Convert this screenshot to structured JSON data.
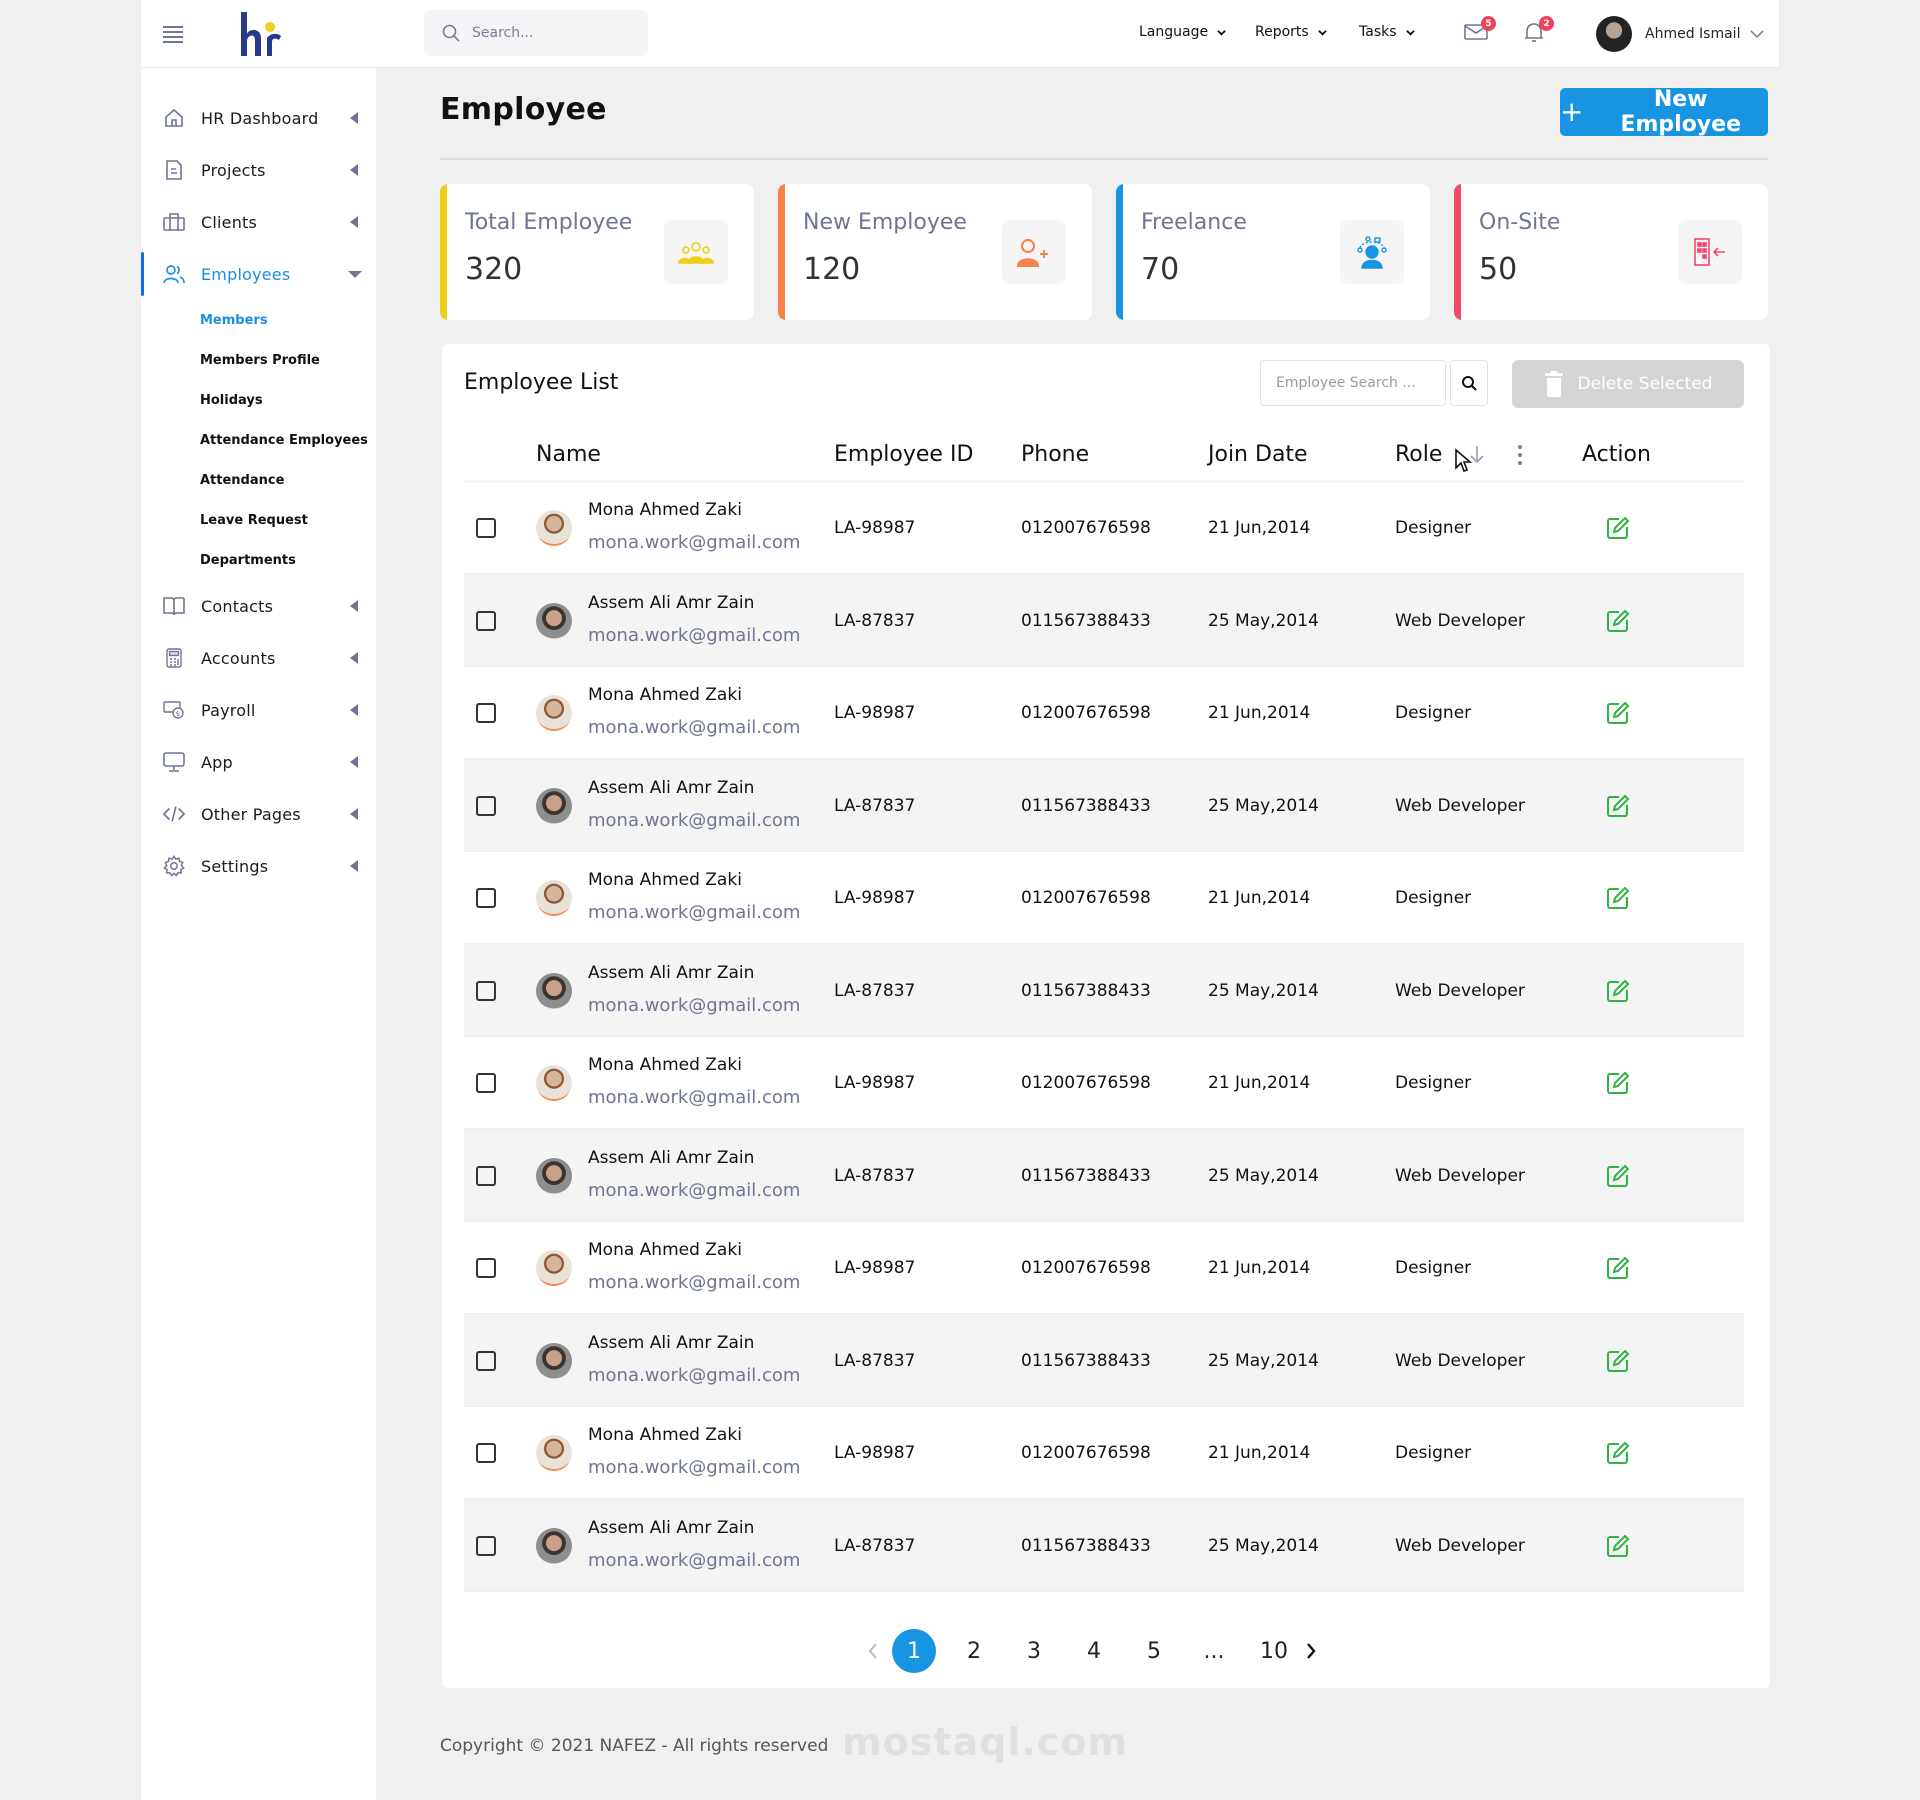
{
  "topbar": {
    "search_placeholder": "Search...",
    "menus": [
      {
        "label": "Language"
      },
      {
        "label": "Reports"
      },
      {
        "label": "Tasks"
      }
    ],
    "mail_count": "5",
    "notification_count": "2",
    "user_name": "Ahmed Ismail"
  },
  "sidebar": {
    "items": [
      {
        "label": "HR Dashboard",
        "icon": "home-icon"
      },
      {
        "label": "Projects",
        "icon": "document-icon"
      },
      {
        "label": "Clients",
        "icon": "briefcase-icon"
      },
      {
        "label": "Employees",
        "icon": "users-icon",
        "active": true
      },
      {
        "label": "Contacts",
        "icon": "book-icon"
      },
      {
        "label": "Accounts",
        "icon": "calculator-icon"
      },
      {
        "label": "Payroll",
        "icon": "money-icon"
      },
      {
        "label": "App",
        "icon": "monitor-icon"
      },
      {
        "label": "Other Pages",
        "icon": "code-icon"
      },
      {
        "label": "Settings",
        "icon": "gear-icon"
      }
    ],
    "sub_items": [
      {
        "label": "Members",
        "active": true
      },
      {
        "label": "Members Profile"
      },
      {
        "label": "Holidays"
      },
      {
        "label": "Attendance Employees"
      },
      {
        "label": "Attendance"
      },
      {
        "label": "Leave Request"
      },
      {
        "label": "Departments"
      }
    ]
  },
  "page": {
    "title": "Employee",
    "new_button": "New Employee"
  },
  "stats": [
    {
      "title": "Total Employee",
      "value": "320",
      "color": "#ecd019",
      "icon": "team-icon"
    },
    {
      "title": "New Employee",
      "value": "120",
      "color": "#f7834a",
      "icon": "add-user-icon"
    },
    {
      "title": "Freelance",
      "value": "70",
      "color": "#1795e2",
      "icon": "freelancer-icon"
    },
    {
      "title": "On-Site",
      "value": "50",
      "color": "#f4476b",
      "icon": "building-enter-icon"
    }
  ],
  "employee_list": {
    "title": "Employee List",
    "search_placeholder": "Employee Search ...",
    "delete_button": "Delete Selected",
    "columns": [
      "Name",
      "Employee ID",
      "Phone",
      "Join Date",
      "Role",
      "Action"
    ],
    "rows": [
      {
        "name": "Mona Ahmed Zaki",
        "email": "mona.work@gmail.com",
        "id": "LA-98987",
        "phone": "012007676598",
        "join": "21 Jun,2014",
        "role": "Designer"
      },
      {
        "name": "Assem Ali Amr Zain",
        "email": "mona.work@gmail.com",
        "id": "LA-87837",
        "phone": "011567388433",
        "join": "25 May,2014",
        "role": "Web Developer"
      },
      {
        "name": "Mona Ahmed Zaki",
        "email": "mona.work@gmail.com",
        "id": "LA-98987",
        "phone": "012007676598",
        "join": "21 Jun,2014",
        "role": "Designer"
      },
      {
        "name": "Assem Ali Amr Zain",
        "email": "mona.work@gmail.com",
        "id": "LA-87837",
        "phone": "011567388433",
        "join": "25 May,2014",
        "role": "Web Developer"
      },
      {
        "name": "Mona Ahmed Zaki",
        "email": "mona.work@gmail.com",
        "id": "LA-98987",
        "phone": "012007676598",
        "join": "21 Jun,2014",
        "role": "Designer"
      },
      {
        "name": "Assem Ali Amr Zain",
        "email": "mona.work@gmail.com",
        "id": "LA-87837",
        "phone": "011567388433",
        "join": "25 May,2014",
        "role": "Web Developer"
      },
      {
        "name": "Mona Ahmed Zaki",
        "email": "mona.work@gmail.com",
        "id": "LA-98987",
        "phone": "012007676598",
        "join": "21 Jun,2014",
        "role": "Designer"
      },
      {
        "name": "Assem Ali Amr Zain",
        "email": "mona.work@gmail.com",
        "id": "LA-87837",
        "phone": "011567388433",
        "join": "25 May,2014",
        "role": "Web Developer"
      },
      {
        "name": "Mona Ahmed Zaki",
        "email": "mona.work@gmail.com",
        "id": "LA-98987",
        "phone": "012007676598",
        "join": "21 Jun,2014",
        "role": "Designer"
      },
      {
        "name": "Assem Ali Amr Zain",
        "email": "mona.work@gmail.com",
        "id": "LA-87837",
        "phone": "011567388433",
        "join": "25 May,2014",
        "role": "Web Developer"
      },
      {
        "name": "Mona Ahmed Zaki",
        "email": "mona.work@gmail.com",
        "id": "LA-98987",
        "phone": "012007676598",
        "join": "21 Jun,2014",
        "role": "Designer"
      },
      {
        "name": "Assem Ali Amr Zain",
        "email": "mona.work@gmail.com",
        "id": "LA-87837",
        "phone": "011567388433",
        "join": "25 May,2014",
        "role": "Web Developer"
      }
    ]
  },
  "pagination": {
    "pages": [
      "1",
      "2",
      "3",
      "4",
      "5",
      "...",
      "10"
    ],
    "current": "1"
  },
  "footer": {
    "copyright": "Copyright © 2021 NAFEZ - All rights reserved",
    "watermark": "mostaql.com"
  },
  "colors": {
    "accent": "#1795e2",
    "active_nav": "#0a6cf2",
    "edit_icon": "#2fb344",
    "badge": "#f0435a"
  }
}
